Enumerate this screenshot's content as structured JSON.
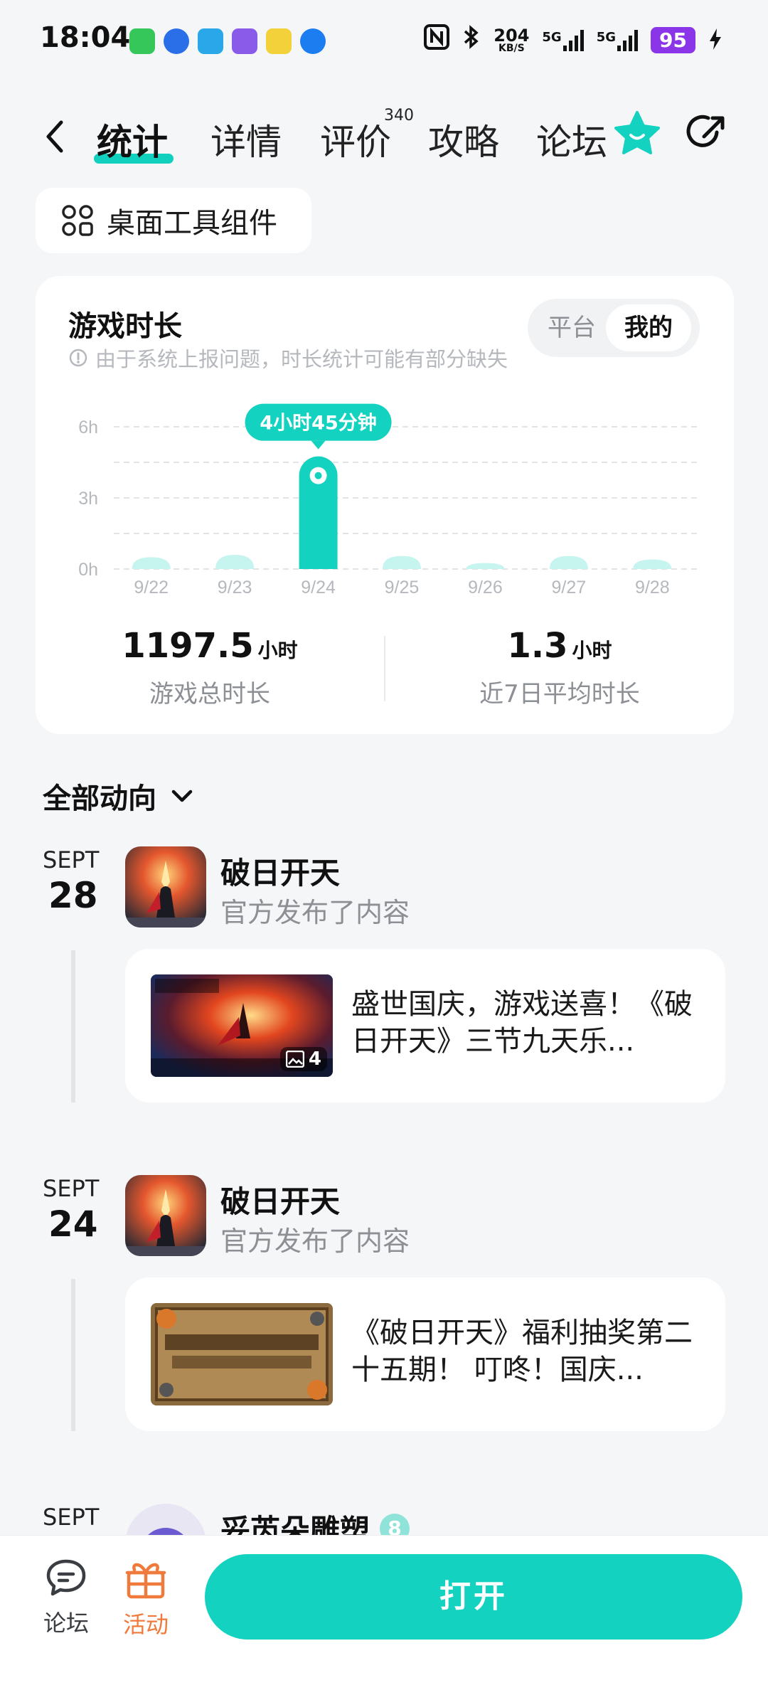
{
  "status_bar": {
    "time": "18:04",
    "speed_top": "204",
    "speed_bottom": "KB/S",
    "net1": "5G",
    "net2": "5G",
    "battery": "95"
  },
  "tabs": {
    "items": [
      {
        "label": "统计"
      },
      {
        "label": "详情"
      },
      {
        "label": "评价"
      },
      {
        "label": "攻略"
      },
      {
        "label": "论坛"
      }
    ],
    "review_count": "340"
  },
  "widget_chip": {
    "label": "桌面工具组件"
  },
  "play_time": {
    "title": "游戏时长",
    "notice": "由于系统上报问题，时长统计可能有部分缺失",
    "toggle": {
      "platform": "平台",
      "mine": "我的"
    },
    "total_value": "1197.5",
    "total_unit": "小时",
    "total_label": "游戏总时长",
    "avg_value": "1.3",
    "avg_unit": "小时",
    "avg_label": "近7日平均时长"
  },
  "chart_data": {
    "type": "bar",
    "categories": [
      "9/22",
      "9/23",
      "9/24",
      "9/25",
      "9/26",
      "9/27",
      "9/28"
    ],
    "values": [
      0.5,
      0.6,
      4.75,
      0.55,
      0.25,
      0.55,
      0.4
    ],
    "yticks": [
      "0h",
      "3h",
      "6h"
    ],
    "ylim": [
      0,
      6
    ],
    "grid": true,
    "highlight_index": 2,
    "highlight_label": "4小时45分钟",
    "color": "#14d2c0",
    "light_color": "#c6f4ef"
  },
  "feed": {
    "filter_label": "全部动向",
    "entries": [
      {
        "month": "SEPT",
        "day": "28",
        "name": "破日开天",
        "action": "官方发布了内容",
        "post_title": "盛世国庆，游戏送喜！《破日开天》三节九天乐...",
        "image_count": "4"
      },
      {
        "month": "SEPT",
        "day": "24",
        "name": "破日开天",
        "action": "官方发布了内容",
        "post_title": "《破日开天》福利抽奖第二十五期！ 叮咚！国庆..."
      },
      {
        "month": "SEPT",
        "name": "妥芮朵雕塑",
        "level": "8"
      }
    ]
  },
  "bottom_bar": {
    "forum": "论坛",
    "activity": "活动",
    "open": "打开",
    "accent": "#14d2c0",
    "activity_color": "#f07a3b"
  }
}
